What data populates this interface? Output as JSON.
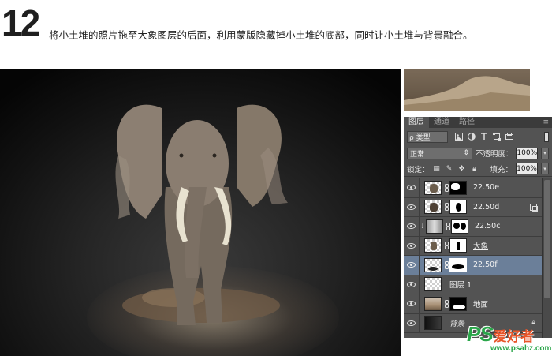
{
  "step": {
    "number": "12",
    "caption": "将小土堆的照片拖至大象图层的后面，利用蒙版隐藏掉小土堆的底部，同时让小土堆与背景融合。"
  },
  "panel": {
    "tabs": [
      "图层",
      "通道",
      "路径"
    ],
    "active_tab": 0,
    "filter": {
      "kind_label": "ρ 类型"
    },
    "blend": {
      "mode": "正常",
      "opacity_label": "不透明度：",
      "opacity": "100%"
    },
    "lock": {
      "label": "锁定：",
      "fill_label": "填充：",
      "fill": "100%"
    },
    "layers": [
      {
        "name": "22.50e",
        "selected": false
      },
      {
        "name": "22.50d",
        "selected": false
      },
      {
        "name": "22.50c",
        "selected": false
      },
      {
        "name": "大象",
        "selected": false
      },
      {
        "name": "22.50f",
        "selected": true
      },
      {
        "name": "图层 1",
        "selected": false
      },
      {
        "name": "地面",
        "selected": false
      },
      {
        "name": "背景",
        "selected": false
      }
    ]
  },
  "watermark": {
    "logo": "PS",
    "cn": "爱好者",
    "url": "www.psahz.com"
  },
  "colors": {
    "selected_layer": "#6b7f99",
    "panel_bg": "#535353",
    "watermark_green": "#2aa64a",
    "watermark_orange": "#e8552a"
  },
  "icons": [
    "eye-icon",
    "link-icon",
    "lock-icon",
    "smart-object-icon",
    "panel-menu-icon",
    "pixel-filter-icon",
    "adjustment-filter-icon",
    "type-filter-icon",
    "shape-filter-icon",
    "smart-filter-icon"
  ]
}
